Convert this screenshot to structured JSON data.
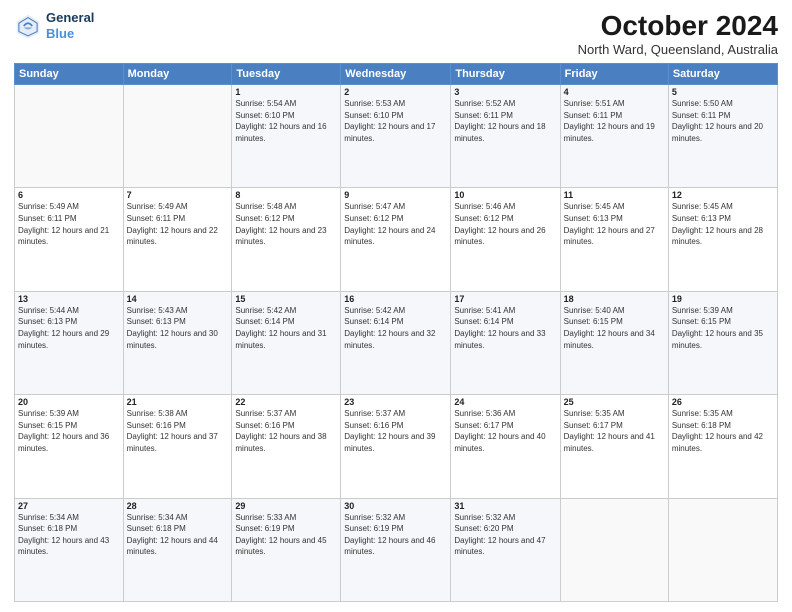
{
  "header": {
    "logo_line1": "General",
    "logo_line2": "Blue",
    "month": "October 2024",
    "location": "North Ward, Queensland, Australia"
  },
  "weekdays": [
    "Sunday",
    "Monday",
    "Tuesday",
    "Wednesday",
    "Thursday",
    "Friday",
    "Saturday"
  ],
  "weeks": [
    [
      {
        "day": "",
        "sunrise": "",
        "sunset": "",
        "daylight": ""
      },
      {
        "day": "",
        "sunrise": "",
        "sunset": "",
        "daylight": ""
      },
      {
        "day": "1",
        "sunrise": "Sunrise: 5:54 AM",
        "sunset": "Sunset: 6:10 PM",
        "daylight": "Daylight: 12 hours and 16 minutes."
      },
      {
        "day": "2",
        "sunrise": "Sunrise: 5:53 AM",
        "sunset": "Sunset: 6:10 PM",
        "daylight": "Daylight: 12 hours and 17 minutes."
      },
      {
        "day": "3",
        "sunrise": "Sunrise: 5:52 AM",
        "sunset": "Sunset: 6:11 PM",
        "daylight": "Daylight: 12 hours and 18 minutes."
      },
      {
        "day": "4",
        "sunrise": "Sunrise: 5:51 AM",
        "sunset": "Sunset: 6:11 PM",
        "daylight": "Daylight: 12 hours and 19 minutes."
      },
      {
        "day": "5",
        "sunrise": "Sunrise: 5:50 AM",
        "sunset": "Sunset: 6:11 PM",
        "daylight": "Daylight: 12 hours and 20 minutes."
      }
    ],
    [
      {
        "day": "6",
        "sunrise": "Sunrise: 5:49 AM",
        "sunset": "Sunset: 6:11 PM",
        "daylight": "Daylight: 12 hours and 21 minutes."
      },
      {
        "day": "7",
        "sunrise": "Sunrise: 5:49 AM",
        "sunset": "Sunset: 6:11 PM",
        "daylight": "Daylight: 12 hours and 22 minutes."
      },
      {
        "day": "8",
        "sunrise": "Sunrise: 5:48 AM",
        "sunset": "Sunset: 6:12 PM",
        "daylight": "Daylight: 12 hours and 23 minutes."
      },
      {
        "day": "9",
        "sunrise": "Sunrise: 5:47 AM",
        "sunset": "Sunset: 6:12 PM",
        "daylight": "Daylight: 12 hours and 24 minutes."
      },
      {
        "day": "10",
        "sunrise": "Sunrise: 5:46 AM",
        "sunset": "Sunset: 6:12 PM",
        "daylight": "Daylight: 12 hours and 26 minutes."
      },
      {
        "day": "11",
        "sunrise": "Sunrise: 5:45 AM",
        "sunset": "Sunset: 6:13 PM",
        "daylight": "Daylight: 12 hours and 27 minutes."
      },
      {
        "day": "12",
        "sunrise": "Sunrise: 5:45 AM",
        "sunset": "Sunset: 6:13 PM",
        "daylight": "Daylight: 12 hours and 28 minutes."
      }
    ],
    [
      {
        "day": "13",
        "sunrise": "Sunrise: 5:44 AM",
        "sunset": "Sunset: 6:13 PM",
        "daylight": "Daylight: 12 hours and 29 minutes."
      },
      {
        "day": "14",
        "sunrise": "Sunrise: 5:43 AM",
        "sunset": "Sunset: 6:13 PM",
        "daylight": "Daylight: 12 hours and 30 minutes."
      },
      {
        "day": "15",
        "sunrise": "Sunrise: 5:42 AM",
        "sunset": "Sunset: 6:14 PM",
        "daylight": "Daylight: 12 hours and 31 minutes."
      },
      {
        "day": "16",
        "sunrise": "Sunrise: 5:42 AM",
        "sunset": "Sunset: 6:14 PM",
        "daylight": "Daylight: 12 hours and 32 minutes."
      },
      {
        "day": "17",
        "sunrise": "Sunrise: 5:41 AM",
        "sunset": "Sunset: 6:14 PM",
        "daylight": "Daylight: 12 hours and 33 minutes."
      },
      {
        "day": "18",
        "sunrise": "Sunrise: 5:40 AM",
        "sunset": "Sunset: 6:15 PM",
        "daylight": "Daylight: 12 hours and 34 minutes."
      },
      {
        "day": "19",
        "sunrise": "Sunrise: 5:39 AM",
        "sunset": "Sunset: 6:15 PM",
        "daylight": "Daylight: 12 hours and 35 minutes."
      }
    ],
    [
      {
        "day": "20",
        "sunrise": "Sunrise: 5:39 AM",
        "sunset": "Sunset: 6:15 PM",
        "daylight": "Daylight: 12 hours and 36 minutes."
      },
      {
        "day": "21",
        "sunrise": "Sunrise: 5:38 AM",
        "sunset": "Sunset: 6:16 PM",
        "daylight": "Daylight: 12 hours and 37 minutes."
      },
      {
        "day": "22",
        "sunrise": "Sunrise: 5:37 AM",
        "sunset": "Sunset: 6:16 PM",
        "daylight": "Daylight: 12 hours and 38 minutes."
      },
      {
        "day": "23",
        "sunrise": "Sunrise: 5:37 AM",
        "sunset": "Sunset: 6:16 PM",
        "daylight": "Daylight: 12 hours and 39 minutes."
      },
      {
        "day": "24",
        "sunrise": "Sunrise: 5:36 AM",
        "sunset": "Sunset: 6:17 PM",
        "daylight": "Daylight: 12 hours and 40 minutes."
      },
      {
        "day": "25",
        "sunrise": "Sunrise: 5:35 AM",
        "sunset": "Sunset: 6:17 PM",
        "daylight": "Daylight: 12 hours and 41 minutes."
      },
      {
        "day": "26",
        "sunrise": "Sunrise: 5:35 AM",
        "sunset": "Sunset: 6:18 PM",
        "daylight": "Daylight: 12 hours and 42 minutes."
      }
    ],
    [
      {
        "day": "27",
        "sunrise": "Sunrise: 5:34 AM",
        "sunset": "Sunset: 6:18 PM",
        "daylight": "Daylight: 12 hours and 43 minutes."
      },
      {
        "day": "28",
        "sunrise": "Sunrise: 5:34 AM",
        "sunset": "Sunset: 6:18 PM",
        "daylight": "Daylight: 12 hours and 44 minutes."
      },
      {
        "day": "29",
        "sunrise": "Sunrise: 5:33 AM",
        "sunset": "Sunset: 6:19 PM",
        "daylight": "Daylight: 12 hours and 45 minutes."
      },
      {
        "day": "30",
        "sunrise": "Sunrise: 5:32 AM",
        "sunset": "Sunset: 6:19 PM",
        "daylight": "Daylight: 12 hours and 46 minutes."
      },
      {
        "day": "31",
        "sunrise": "Sunrise: 5:32 AM",
        "sunset": "Sunset: 6:20 PM",
        "daylight": "Daylight: 12 hours and 47 minutes."
      },
      {
        "day": "",
        "sunrise": "",
        "sunset": "",
        "daylight": ""
      },
      {
        "day": "",
        "sunrise": "",
        "sunset": "",
        "daylight": ""
      }
    ]
  ]
}
